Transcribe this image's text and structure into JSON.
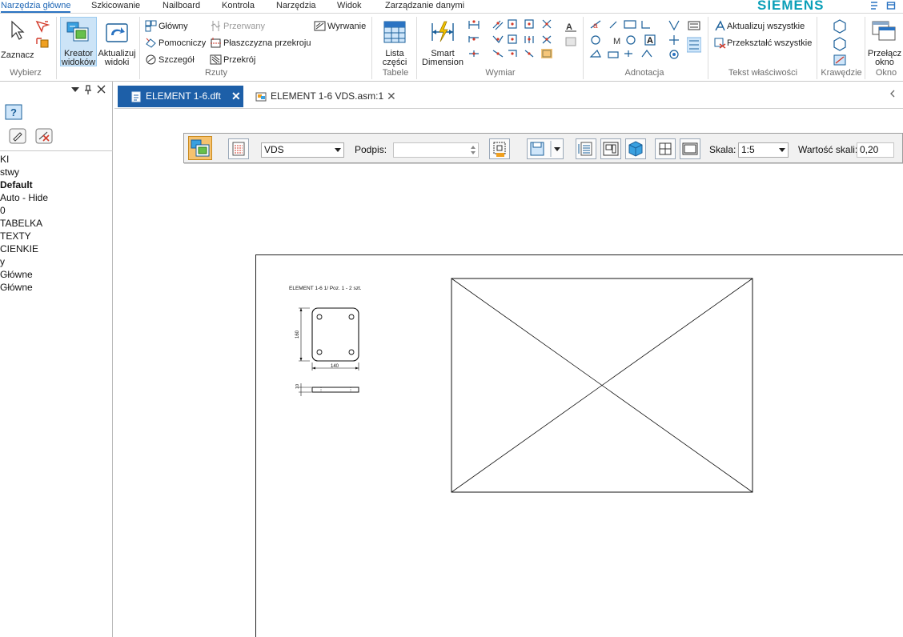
{
  "menu": {
    "tabs": [
      "Narzędzia główne",
      "Szkicowanie",
      "Nailboard",
      "Kontrola",
      "Narzędzia",
      "Widok",
      "Zarządzanie danymi"
    ],
    "brand": "SIEMENS"
  },
  "ribbon": {
    "groups": {
      "wybierz": "Wybierz",
      "rzuty": "Rzuty",
      "tabele": "Tabele",
      "wymiar": "Wymiar",
      "adnotacja": "Adnotacja",
      "tekst": "Tekst właściwości",
      "krawedzie": "Krawędzie",
      "okno": "Okno"
    },
    "zaznacz": "Zaznacz",
    "kreator_1": "Kreator",
    "kreator_2": "widoków",
    "aktualizuj_1": "Aktualizuj",
    "aktualizuj_2": "widoki",
    "glowny": "Główny",
    "pomocniczy": "Pomocniczy",
    "szczegol": "Szczegół",
    "przerwany": "Przerwany",
    "plaszczyzna": "Płaszczyzna przekroju",
    "przekroj": "Przekrój",
    "wyrwanie": "Wyrwanie",
    "lista_1": "Lista",
    "lista_2": "części",
    "smart_1": "Smart",
    "smart_2": "Dimension",
    "akt_wszystkie": "Aktualizuj wszystkie",
    "przeksztalc": "Przekształć wszystkie",
    "przelacz_1": "Przełącz",
    "przelacz_2": "okno"
  },
  "left_panel": {
    "items": [
      "KI",
      "stwy",
      "Default",
      "Auto - Hide",
      "0",
      "TABELKA",
      "TEXTY",
      "CIENKIE",
      "y",
      "Główne",
      "Główne"
    ]
  },
  "doc_tabs": [
    {
      "label": "ELEMENT 1-6.dft",
      "active": true
    },
    {
      "label": "ELEMENT 1-6 VDS.asm:1",
      "active": false
    }
  ],
  "view_toolbar": {
    "view_select": "VDS",
    "podpis_label": "Podpis:",
    "podpis_value": "",
    "skala_label": "Skala:",
    "skala_value": "1:5",
    "wartosc_label": "Wartość skali:",
    "wartosc_value": "0,20"
  },
  "drawing": {
    "title": "ELEMENT 1-6 1/ Poz. 1 - 2 szt.",
    "dim_width": "140",
    "dim_height": "160",
    "dim_thickness": "10"
  },
  "colors": {
    "accent": "#1d5fa8",
    "brand": "#0a9fb8",
    "selected": "#cce4f7"
  }
}
